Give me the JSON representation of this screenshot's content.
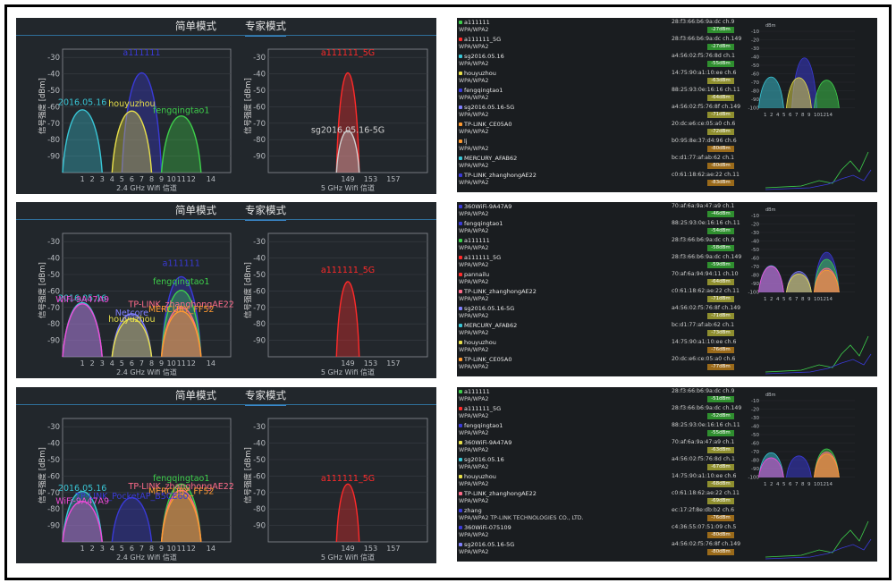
{
  "tabs": {
    "simple": "简单模式",
    "expert": "专家模式"
  },
  "y_axis_label": "信号强度 [dBm]",
  "y_ticks": [
    "-30",
    "-40",
    "-50",
    "-60",
    "-70",
    "-80",
    "-90"
  ],
  "x24_ticks": [
    "1",
    "2",
    "3",
    "4",
    "5",
    "6",
    "7",
    "8",
    "9",
    "10",
    "11",
    "12",
    "",
    "14"
  ],
  "x24_ticks_alt": [
    "1",
    "2",
    "4",
    "5",
    "6",
    "7",
    "8",
    "9",
    "10",
    "12",
    "14"
  ],
  "x5_ticks": [
    "149",
    "153",
    "157"
  ],
  "x24_label": "2.4 GHz Wifi 信道",
  "x5_label": "5 GHz Wifi 信道",
  "screens": [
    {
      "g24": [
        {
          "name": "a111111",
          "ch": 7,
          "dbm": -30,
          "color": "#3a3ad8"
        },
        {
          "name": "2016.05.16",
          "ch": 1,
          "dbm": -60,
          "color": "#39c6d6"
        },
        {
          "name": "houyuzhou",
          "ch": 6,
          "dbm": -61,
          "color": "#e8e04a"
        },
        {
          "name": "fengqingtao1",
          "ch": 11,
          "dbm": -65,
          "color": "#3ed04b"
        }
      ],
      "g5": [
        {
          "name": "a111111_5G",
          "ch": 149,
          "dbm": -30,
          "color": "#ff2a2a"
        },
        {
          "name": "sg2016.05.16-5G",
          "ch": 149,
          "dbm": -77,
          "color": "#d0d0d0"
        }
      ]
    },
    {
      "g24": [
        {
          "name": "a111111",
          "ch": 11,
          "dbm": -46,
          "color": "#3a3ad8"
        },
        {
          "name": "fengqingtao1",
          "ch": 11,
          "dbm": -57,
          "color": "#3ed04b"
        },
        {
          "name": "2016.05.16",
          "ch": 1,
          "dbm": -67,
          "color": "#39c6d6"
        },
        {
          "name": "WiFi-9A47A9",
          "ch": 1,
          "dbm": -68,
          "color": "#f04ad8"
        },
        {
          "name": "TP-LINK_zhanghongAE22",
          "ch": 11,
          "dbm": -71,
          "color": "#ff6b8a"
        },
        {
          "name": "Netcore",
          "ch": 6,
          "dbm": -76,
          "color": "#8080ff"
        },
        {
          "name": "MERCURY_FF52",
          "ch": 11,
          "dbm": -74,
          "color": "#ff9a30"
        },
        {
          "name": "houyuzhou",
          "ch": 6,
          "dbm": -80,
          "color": "#e8e04a"
        }
      ],
      "g5": [
        {
          "name": "a111111_5G",
          "ch": 149,
          "dbm": -50,
          "color": "#ff2a2a"
        }
      ]
    },
    {
      "g24": [
        {
          "name": "fengqingtao1",
          "ch": 11,
          "dbm": -64,
          "color": "#3ed04b"
        },
        {
          "name": "2016.05.16",
          "ch": 1,
          "dbm": -70,
          "color": "#39c6d6"
        },
        {
          "name": "TP-LINK_zhanghongAE22",
          "ch": 11,
          "dbm": -69,
          "color": "#ff6b8a"
        },
        {
          "name": "MERCURY_FF52",
          "ch": 11,
          "dbm": -72,
          "color": "#ff9a30"
        },
        {
          "name": "TP-LINK_PocketAP_B5CE60",
          "ch": 6,
          "dbm": -75,
          "color": "#3a3ad8"
        },
        {
          "name": "WiFi-9A47A9",
          "ch": 1,
          "dbm": -78,
          "color": "#f04ad8"
        }
      ],
      "g5": [
        {
          "name": "a111111_5G",
          "ch": 149,
          "dbm": -64,
          "color": "#ff2a2a"
        }
      ]
    }
  ],
  "lists": [
    [
      {
        "name": "a111111",
        "mac": "28:f3:66:b6:9a:dc",
        "ch": "ch.9",
        "sec": "WPA/WPA2",
        "dbm": "-27dBm",
        "color": "#3ed04b"
      },
      {
        "name": "a111111_5G",
        "mac": "28:f3:66:b6:9a:dc",
        "ch": "ch.149",
        "sec": "WPA/WPA2",
        "dbm": "-27dBm",
        "color": "#ff2a2a"
      },
      {
        "name": "sg2016.05.16",
        "mac": "a4:56:02:f5:76:8d",
        "ch": "ch.1",
        "sec": "WPA/WPA2",
        "dbm": "-55dBm",
        "color": "#39c6d6"
      },
      {
        "name": "houyuzhou",
        "mac": "14:75:90:a1:10:ee",
        "ch": "ch.6",
        "sec": "WPA/WPA2",
        "dbm": "-63dBm",
        "color": "#e8e04a"
      },
      {
        "name": "fengqingtao1",
        "mac": "88:25:93:0e:16:16",
        "ch": "ch.11",
        "sec": "WPA/WPA2",
        "dbm": "-64dBm",
        "color": "#3a3ad8"
      },
      {
        "name": "sg2016.05.16-5G",
        "mac": "a4:56:02:f5:76:8f",
        "ch": "ch.149",
        "sec": "WPA/WPA2",
        "dbm": "-71dBm",
        "color": "#8080ff"
      },
      {
        "name": "TP-LINK_CE05A0",
        "mac": "20:dc:e6:ce:05:a0",
        "ch": "ch.6",
        "sec": "WPA/WPA2",
        "dbm": "-72dBm",
        "color": "#ff9a30"
      },
      {
        "name": "lj",
        "mac": "b0:95:8e:37:d4:96",
        "ch": "ch.6",
        "sec": "WPA/WPA2",
        "dbm": "-80dBm",
        "color": "#ff9a30"
      },
      {
        "name": "MERCURY_AFAB62",
        "mac": "bc:d1:77:af:ab:62",
        "ch": "ch.1",
        "sec": "WPA/WPA2",
        "dbm": "-80dBm",
        "color": "#39c6d6"
      },
      {
        "name": "TP-LINK_zhanghongAE22",
        "mac": "c0:61:18:62:ae:22",
        "ch": "ch.11",
        "sec": "WPA/WPA2",
        "dbm": "-83dBm",
        "color": "#3a3ad8"
      }
    ],
    [
      {
        "name": "360WiFi-9A47A9",
        "mac": "70:af:6a:9a:47:a9",
        "ch": "ch.1",
        "sec": "WPA/WPA2",
        "dbm": "-46dBm",
        "color": "#3a3ad8"
      },
      {
        "name": "fengqingtao1",
        "mac": "88:25:93:0e:16:16",
        "ch": "ch.11",
        "sec": "WPA/WPA2",
        "dbm": "-54dBm",
        "color": "#3a3ad8"
      },
      {
        "name": "a111111",
        "mac": "28:f3:66:b6:9a:dc",
        "ch": "ch.9",
        "sec": "WPA/WPA2",
        "dbm": "-58dBm",
        "color": "#3ed04b"
      },
      {
        "name": "a111111_5G",
        "mac": "28:f3:66:b6:9a:dc",
        "ch": "ch.149",
        "sec": "WPA/WPA2",
        "dbm": "-59dBm",
        "color": "#ff2a2a"
      },
      {
        "name": "pannailu",
        "mac": "70:af:6a:94:94:11",
        "ch": "ch.10",
        "sec": "WPA/WPA2",
        "dbm": "-64dBm",
        "color": "#ff2a2a"
      },
      {
        "name": "TP-LINK_zhanghongAE22",
        "mac": "c0:61:18:62:ae:22",
        "ch": "ch.11",
        "sec": "WPA/WPA2",
        "dbm": "-71dBm",
        "color": "#ff6b8a"
      },
      {
        "name": "sg2016.05.16-5G",
        "mac": "a4:56:02:f5:76:8f",
        "ch": "ch.149",
        "sec": "WPA/WPA2",
        "dbm": "-71dBm",
        "color": "#8080ff"
      },
      {
        "name": "MERCURY_AFAB62",
        "mac": "bc:d1:77:af:ab:62",
        "ch": "ch.1",
        "sec": "WPA/WPA2",
        "dbm": "-73dBm",
        "color": "#39c6d6"
      },
      {
        "name": "houyuzhou",
        "mac": "14:75:90:a1:10:ee",
        "ch": "ch.6",
        "sec": "WPA/WPA2",
        "dbm": "-76dBm",
        "color": "#e8e04a"
      },
      {
        "name": "TP-LINK_CE05A0",
        "mac": "20:dc:e6:ce:05:a0",
        "ch": "ch.6",
        "sec": "WPA/WPA2",
        "dbm": "-77dBm",
        "color": "#ff9a30"
      }
    ],
    [
      {
        "name": "a111111",
        "mac": "28:f3:66:b6:9a:dc",
        "ch": "ch.9",
        "sec": "WPA/WPA2",
        "dbm": "-51dBm",
        "color": "#3ed04b"
      },
      {
        "name": "a111111_5G",
        "mac": "28:f3:66:b6:9a:dc",
        "ch": "ch.149",
        "sec": "WPA/WPA2",
        "dbm": "-52dBm",
        "color": "#ff2a2a"
      },
      {
        "name": "fengqingtao1",
        "mac": "88:25:93:0e:16:16",
        "ch": "ch.11",
        "sec": "WPA/WPA2",
        "dbm": "-55dBm",
        "color": "#3a3ad8"
      },
      {
        "name": "360WiFi-9A47A9",
        "mac": "70:af:6a:9a:47:a9",
        "ch": "ch.1",
        "sec": "WPA/WPA2",
        "dbm": "-63dBm",
        "color": "#e8e04a"
      },
      {
        "name": "sg2016.05.16",
        "mac": "a4:56:02:f5:76:8d",
        "ch": "ch.1",
        "sec": "WPA/WPA2",
        "dbm": "-67dBm",
        "color": "#39c6d6"
      },
      {
        "name": "houyuzhou",
        "mac": "14:75:90:a1:10:ee",
        "ch": "ch.6",
        "sec": "WPA/WPA2",
        "dbm": "-68dBm",
        "color": "#e8e04a"
      },
      {
        "name": "TP-LINK_zhanghongAE22",
        "mac": "c0:61:18:62:ae:22",
        "ch": "ch.11",
        "sec": "WPA/WPA2",
        "dbm": "-69dBm",
        "color": "#ff6b8a"
      },
      {
        "name": "zhang",
        "mac": "ec:17:2f:8e:db:b2",
        "ch": "ch.6",
        "sec": "WPA/WPA2 TP-LINK TECHNOLOGIES CO., LTD.",
        "dbm": "-76dBm",
        "color": "#3a3ad8"
      },
      {
        "name": "360WiFi-075109",
        "mac": "c4:36:55:07:51:09",
        "ch": "ch.5",
        "sec": "WPA/WPA2",
        "dbm": "-80dBm",
        "color": "#3a3ad8"
      },
      {
        "name": "sg2016.05.16-5G",
        "mac": "a4:56:02:f5:76:8f",
        "ch": "ch.149",
        "sec": "WPA/WPA2",
        "dbm": "-80dBm",
        "color": "#8080ff"
      }
    ]
  ]
}
